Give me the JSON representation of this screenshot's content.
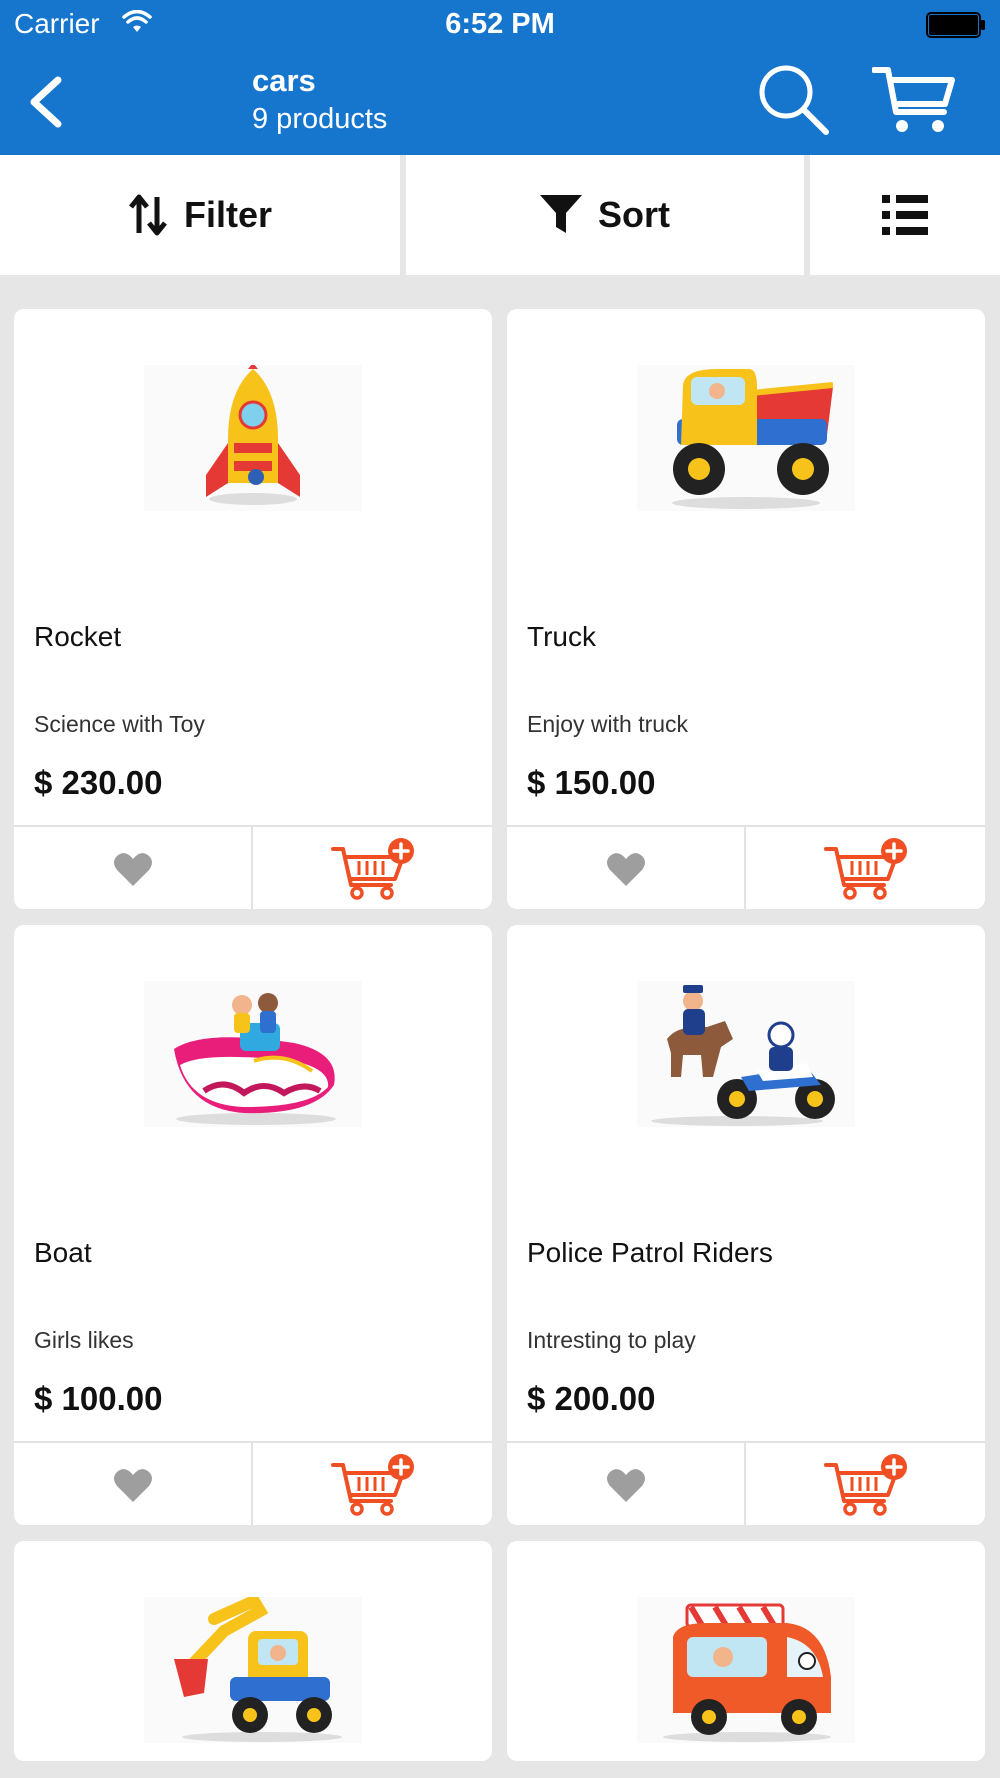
{
  "status_bar": {
    "carrier": "Carrier",
    "time": "6:52 PM"
  },
  "nav": {
    "title": "cars",
    "subtitle": "9 products"
  },
  "toolbar": {
    "filter_label": "Filter",
    "sort_label": "Sort"
  },
  "colors": {
    "primary": "#1675cc",
    "accent": "#f04e23",
    "favorite": "#9e9e9e",
    "background": "#e6e6e6"
  },
  "products": [
    {
      "name": "Rocket",
      "description": "Science with Toy",
      "price": "$ 230.00",
      "image_icon": "rocket-toy-image"
    },
    {
      "name": "Truck",
      "description": "Enjoy with truck",
      "price": "$ 150.00",
      "image_icon": "truck-toy-image"
    },
    {
      "name": "Boat",
      "description": "Girls likes",
      "price": "$ 100.00",
      "image_icon": "boat-toy-image"
    },
    {
      "name": "Police Patrol Riders",
      "description": "Intresting to play",
      "price": "$ 200.00",
      "image_icon": "police-riders-toy-image"
    },
    {
      "name": "",
      "description": "",
      "price": "",
      "image_icon": "digger-toy-image"
    },
    {
      "name": "",
      "description": "",
      "price": "",
      "image_icon": "ice-cream-van-toy-image"
    }
  ]
}
